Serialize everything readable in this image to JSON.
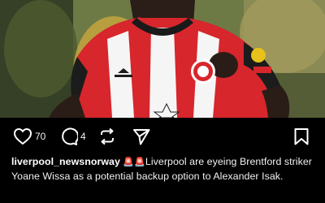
{
  "post": {
    "likes": "70",
    "comments": "4",
    "username": "liverpool_newsnorway",
    "emoji": "🚨🚨",
    "caption_text": "Liverpool are eyeing Brentford striker Yoane Wissa as a potential backup option to Alexander Isak."
  },
  "photo": {
    "description_icons": "photo-of-footballer"
  },
  "colors": {
    "background": "#000000",
    "jersey_red": "#d7262c",
    "jersey_white": "#f5f5f5",
    "text": "#f1f1f1"
  }
}
